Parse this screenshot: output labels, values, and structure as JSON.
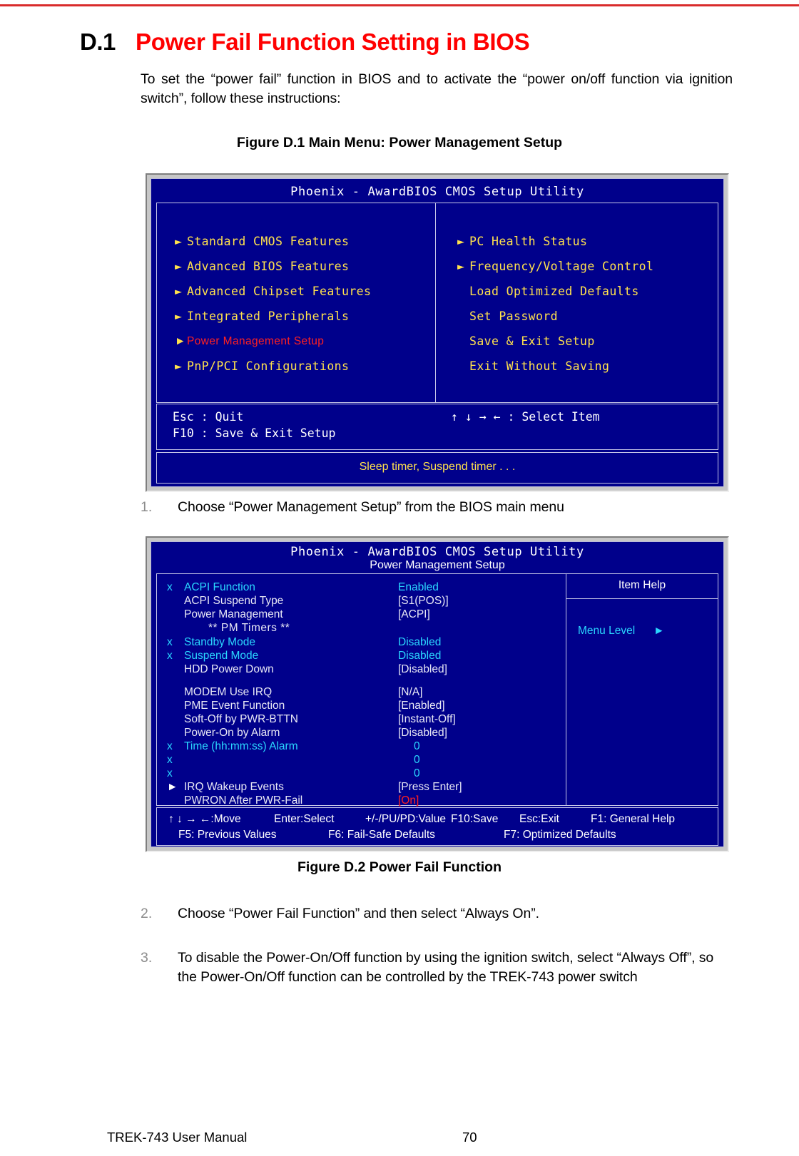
{
  "heading": {
    "number": "D.1",
    "title": "Power Fail Function Setting in BIOS"
  },
  "intro": "To set the “power fail” function in BIOS and to activate the “power on/off function via ignition switch”, follow these instructions:",
  "figures": {
    "fig1_caption": "Figure D.1 Main Menu: Power Management Setup",
    "fig2_caption": "Figure D.2  Power Fail Function"
  },
  "bios_main": {
    "title": "Phoenix - AwardBIOS CMOS Setup Utility",
    "left_items": [
      {
        "label": "Standard CMOS Features",
        "arrow": true,
        "selected": false
      },
      {
        "label": "Advanced BIOS Features",
        "arrow": true,
        "selected": false
      },
      {
        "label": "Advanced Chipset Features",
        "arrow": true,
        "selected": false
      },
      {
        "label": "Integrated Peripherals",
        "arrow": true,
        "selected": false
      },
      {
        "label": "Power Management Setup",
        "arrow": true,
        "selected": true
      },
      {
        "label": "PnP/PCI Configurations",
        "arrow": true,
        "selected": false
      }
    ],
    "right_items": [
      {
        "label": "PC Health Status",
        "arrow": true,
        "selected": false
      },
      {
        "label": "Frequency/Voltage Control",
        "arrow": true,
        "selected": false
      },
      {
        "label": "Load Optimized Defaults",
        "arrow": false,
        "selected": false
      },
      {
        "label": "Set Password",
        "arrow": false,
        "selected": false
      },
      {
        "label": "Save & Exit Setup",
        "arrow": false,
        "selected": false
      },
      {
        "label": "Exit Without Saving",
        "arrow": false,
        "selected": false
      }
    ],
    "keys": {
      "esc": "Esc : Quit",
      "f10": "F10 : Save & Exit Setup",
      "select": "↑ ↓ → ←   : Select Item"
    },
    "hint": "Sleep timer, Suspend timer . . ."
  },
  "bios_pm": {
    "title": "Phoenix - AwardBIOS CMOS Setup Utility",
    "subtitle": "Power Management Setup",
    "rows": [
      {
        "flag": "x",
        "label": "ACPI Function",
        "value": "Enabled",
        "style": "dim"
      },
      {
        "flag": "",
        "label": "ACPI Suspend Type",
        "value": "[S1(POS)]",
        "style": "bright"
      },
      {
        "flag": "",
        "label": "Power Management",
        "value": "[ACPI]",
        "style": "bright"
      },
      {
        "section": "**  PM Timers  **"
      },
      {
        "flag": "x",
        "label": "Standby Mode",
        "value": "Disabled",
        "style": "dim"
      },
      {
        "flag": "x",
        "label": "Suspend Mode",
        "value": "Disabled",
        "style": "dim"
      },
      {
        "flag": "",
        "label": "HDD Power Down",
        "value": "[Disabled]",
        "style": "bright"
      },
      {
        "spacer": true
      },
      {
        "flag": "",
        "label": "MODEM Use IRQ",
        "value": "[N/A]",
        "style": "bright"
      },
      {
        "flag": "",
        "label": "PME Event Function",
        "value": "[Enabled]",
        "style": "bright"
      },
      {
        "flag": "",
        "label": "Soft-Off by PWR-BTTN",
        "value": "[Instant-Off]",
        "style": "bright"
      },
      {
        "flag": "",
        "label": "Power-On by Alarm",
        "value": "[Disabled]",
        "style": "bright"
      },
      {
        "flag": "x",
        "label": "Time (hh:mm:ss) Alarm",
        "value": "0",
        "style": "dim",
        "value_indent": true
      },
      {
        "flag": "x",
        "label": "",
        "value": "0",
        "style": "dim",
        "value_indent": true
      },
      {
        "flag": "x",
        "label": "",
        "value": "0",
        "style": "dim",
        "value_indent": true
      },
      {
        "flag": "►",
        "label": "IRQ Wakeup Events",
        "value": "[Press Enter]",
        "style": "bright"
      },
      {
        "flag": "",
        "label": "PWRON After PWR-Fail",
        "value": "[On]",
        "style": "bright",
        "red_value": true
      }
    ],
    "help": {
      "title": "Item Help",
      "menu_level": "Menu Level",
      "menu_level_arrow": "►"
    },
    "keys_row1": [
      "↑ ↓ → ←:Move",
      "Enter:Select",
      "+/-/PU/PD:Value",
      "F10:Save",
      "Esc:Exit",
      "F1: General Help"
    ],
    "keys_row2": [
      "F5:  Previous Values",
      "F6: Fail-Safe Defaults",
      "F7: Optimized Defaults"
    ]
  },
  "steps": [
    {
      "num": "1.",
      "text": "Choose “Power Management Setup” from the BIOS main menu"
    },
    {
      "num": "2.",
      "text": "Choose “Power Fail Function” and then select “Always On”."
    },
    {
      "num": "3.",
      "text": "To disable the Power-On/Off function by using the ignition switch, select “Always Off”, so the Power-On/Off function can be controlled by the TREK-743 power switch"
    }
  ],
  "footer": {
    "manual": "TREK-743 User Manual",
    "page": "70"
  }
}
